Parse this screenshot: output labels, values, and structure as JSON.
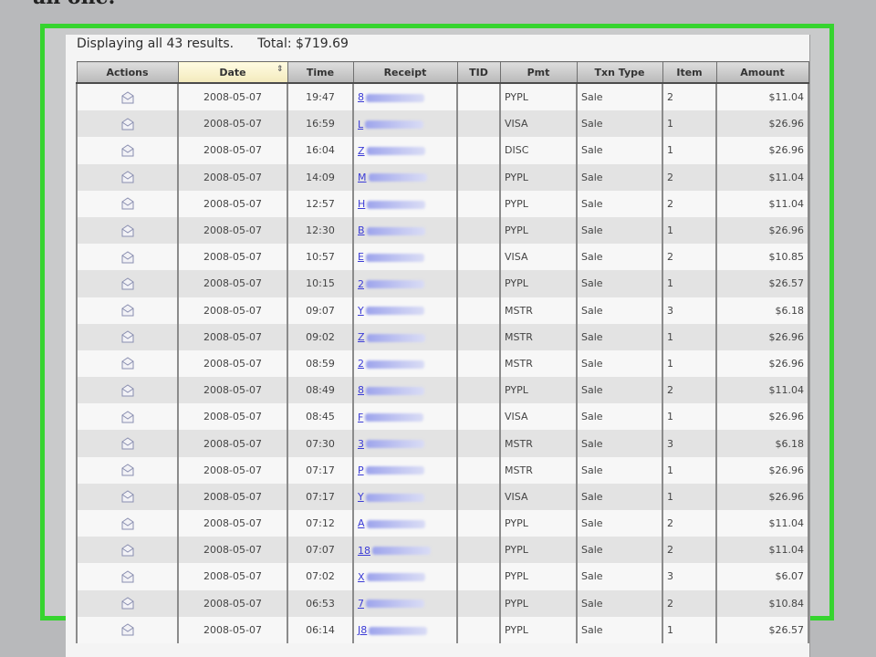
{
  "page": {
    "top_fragment": "an one."
  },
  "summary": {
    "results": "Displaying all 43 results.",
    "total": "Total: $719.69"
  },
  "icons": {
    "row_action": "mail-icon",
    "sort": "sort-arrow-icon"
  },
  "colors": {
    "highlight_frame": "#36d42f",
    "link": "#3b3bd6"
  },
  "table": {
    "columns": [
      "Actions",
      "Date",
      "Time",
      "Receipt",
      "TID",
      "Pmt",
      "Txn Type",
      "Item",
      "Amount"
    ],
    "sorted_column": "Date",
    "rows": [
      {
        "date": "2008-05-07",
        "time": "19:47",
        "receipt": "8",
        "tid": "",
        "pmt": "PYPL",
        "txn": "Sale",
        "item": "2",
        "amount": "$11.04"
      },
      {
        "date": "2008-05-07",
        "time": "16:59",
        "receipt": "L",
        "tid": "",
        "pmt": "VISA",
        "txn": "Sale",
        "item": "1",
        "amount": "$26.96"
      },
      {
        "date": "2008-05-07",
        "time": "16:04",
        "receipt": "Z",
        "tid": "",
        "pmt": "DISC",
        "txn": "Sale",
        "item": "1",
        "amount": "$26.96"
      },
      {
        "date": "2008-05-07",
        "time": "14:09",
        "receipt": "M",
        "tid": "",
        "pmt": "PYPL",
        "txn": "Sale",
        "item": "2",
        "amount": "$11.04"
      },
      {
        "date": "2008-05-07",
        "time": "12:57",
        "receipt": "H",
        "tid": "",
        "pmt": "PYPL",
        "txn": "Sale",
        "item": "2",
        "amount": "$11.04"
      },
      {
        "date": "2008-05-07",
        "time": "12:30",
        "receipt": "B",
        "tid": "",
        "pmt": "PYPL",
        "txn": "Sale",
        "item": "1",
        "amount": "$26.96"
      },
      {
        "date": "2008-05-07",
        "time": "10:57",
        "receipt": "E",
        "tid": "",
        "pmt": "VISA",
        "txn": "Sale",
        "item": "2",
        "amount": "$10.85"
      },
      {
        "date": "2008-05-07",
        "time": "10:15",
        "receipt": "2",
        "tid": "",
        "pmt": "PYPL",
        "txn": "Sale",
        "item": "1",
        "amount": "$26.57"
      },
      {
        "date": "2008-05-07",
        "time": "09:07",
        "receipt": "Y",
        "tid": "",
        "pmt": "MSTR",
        "txn": "Sale",
        "item": "3",
        "amount": "$6.18"
      },
      {
        "date": "2008-05-07",
        "time": "09:02",
        "receipt": "Z",
        "tid": "",
        "pmt": "MSTR",
        "txn": "Sale",
        "item": "1",
        "amount": "$26.96"
      },
      {
        "date": "2008-05-07",
        "time": "08:59",
        "receipt": "2",
        "tid": "",
        "pmt": "MSTR",
        "txn": "Sale",
        "item": "1",
        "amount": "$26.96"
      },
      {
        "date": "2008-05-07",
        "time": "08:49",
        "receipt": "8",
        "tid": "",
        "pmt": "PYPL",
        "txn": "Sale",
        "item": "2",
        "amount": "$11.04"
      },
      {
        "date": "2008-05-07",
        "time": "08:45",
        "receipt": "F",
        "tid": "",
        "pmt": "VISA",
        "txn": "Sale",
        "item": "1",
        "amount": "$26.96"
      },
      {
        "date": "2008-05-07",
        "time": "07:30",
        "receipt": "3",
        "tid": "",
        "pmt": "MSTR",
        "txn": "Sale",
        "item": "3",
        "amount": "$6.18"
      },
      {
        "date": "2008-05-07",
        "time": "07:17",
        "receipt": "P",
        "tid": "",
        "pmt": "MSTR",
        "txn": "Sale",
        "item": "1",
        "amount": "$26.96"
      },
      {
        "date": "2008-05-07",
        "time": "07:17",
        "receipt": "Y",
        "tid": "",
        "pmt": "VISA",
        "txn": "Sale",
        "item": "1",
        "amount": "$26.96"
      },
      {
        "date": "2008-05-07",
        "time": "07:12",
        "receipt": "A",
        "tid": "",
        "pmt": "PYPL",
        "txn": "Sale",
        "item": "2",
        "amount": "$11.04"
      },
      {
        "date": "2008-05-07",
        "time": "07:07",
        "receipt": "18",
        "tid": "",
        "pmt": "PYPL",
        "txn": "Sale",
        "item": "2",
        "amount": "$11.04"
      },
      {
        "date": "2008-05-07",
        "time": "07:02",
        "receipt": "X",
        "tid": "",
        "pmt": "PYPL",
        "txn": "Sale",
        "item": "3",
        "amount": "$6.07"
      },
      {
        "date": "2008-05-07",
        "time": "06:53",
        "receipt": "7",
        "tid": "",
        "pmt": "PYPL",
        "txn": "Sale",
        "item": "2",
        "amount": "$10.84"
      },
      {
        "date": "2008-05-07",
        "time": "06:14",
        "receipt": "J8",
        "tid": "",
        "pmt": "PYPL",
        "txn": "Sale",
        "item": "1",
        "amount": "$26.57"
      }
    ]
  }
}
